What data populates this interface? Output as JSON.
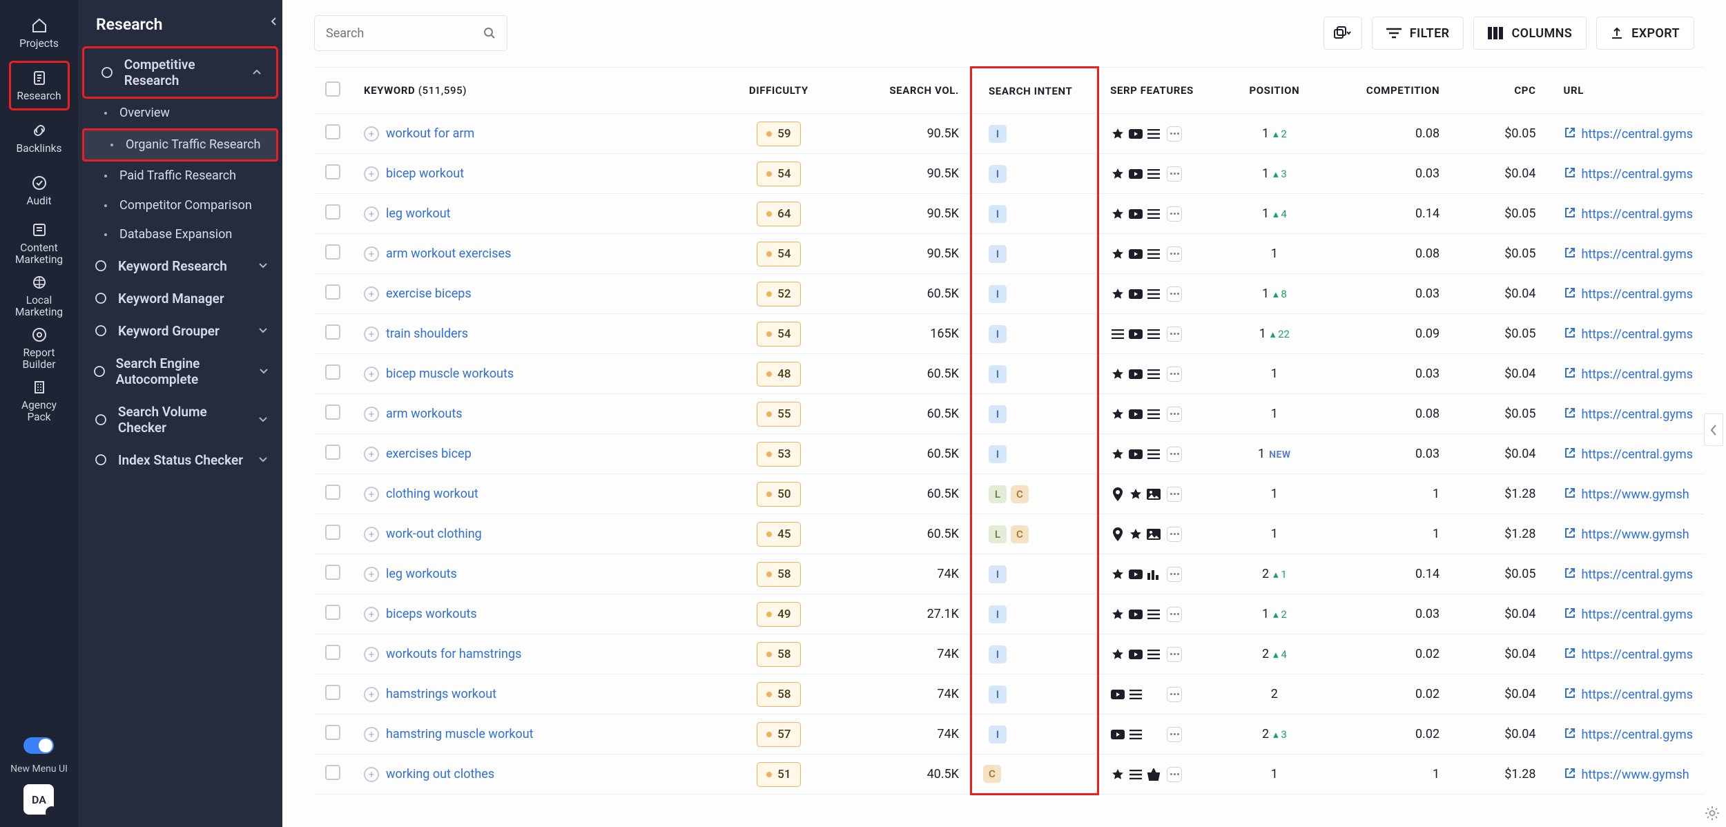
{
  "rail": {
    "items": [
      {
        "label": "Projects",
        "icon": "home-icon"
      },
      {
        "label": "Research",
        "icon": "doc-icon",
        "highlighted": true
      },
      {
        "label": "Backlinks",
        "icon": "link-icon"
      },
      {
        "label": "Audit",
        "icon": "check-icon"
      },
      {
        "label": "Content Marketing",
        "icon": "content-icon"
      },
      {
        "label": "Local Marketing",
        "icon": "local-icon"
      },
      {
        "label": "Report Builder",
        "icon": "report-icon"
      },
      {
        "label": "Agency Pack",
        "icon": "building-icon"
      }
    ],
    "toggle_label": "New Menu UI",
    "avatar": "DA"
  },
  "side": {
    "title": "Research",
    "groups": [
      {
        "label": "Competitive Research",
        "expanded": true,
        "highlighted": true,
        "children": [
          {
            "label": "Overview"
          },
          {
            "label": "Organic Traffic Research",
            "active": true,
            "highlighted": true
          },
          {
            "label": "Paid Traffic Research"
          },
          {
            "label": "Competitor Comparison"
          },
          {
            "label": "Database Expansion",
            "icon": "expand-icon"
          }
        ]
      },
      {
        "label": "Keyword Research",
        "expandable": true
      },
      {
        "label": "Keyword Manager"
      },
      {
        "label": "Keyword Grouper",
        "expandable": true
      },
      {
        "label": "Search Engine Autocomplete",
        "expandable": true
      },
      {
        "label": "Search Volume Checker",
        "expandable": true
      },
      {
        "label": "Index Status Checker",
        "expandable": true
      }
    ]
  },
  "toolbar": {
    "search_placeholder": "Search",
    "filter": "FILTER",
    "columns": "COLUMNS",
    "export": "EXPORT"
  },
  "columns": {
    "keyword": "KEYWORD",
    "keyword_count": "(511,595)",
    "difficulty": "DIFFICULTY",
    "search_vol": "SEARCH VOL.",
    "search_intent": "SEARCH INTENT",
    "serp": "SERP FEATURES",
    "position": "POSITION",
    "competition": "COMPETITION",
    "cpc": "CPC",
    "url": "URL"
  },
  "rows": [
    {
      "kw": "workout for arm",
      "diff": "59",
      "vol": "90.5K",
      "intent": [
        "I"
      ],
      "serp": [
        "star",
        "video",
        "list",
        "more"
      ],
      "pos": "1",
      "delta": "▴ 2",
      "comp": "0.08",
      "cpc": "$0.05",
      "url": "https://central.gyms"
    },
    {
      "kw": "bicep workout",
      "diff": "54",
      "vol": "90.5K",
      "intent": [
        "I"
      ],
      "serp": [
        "star",
        "video",
        "list",
        "more"
      ],
      "pos": "1",
      "delta": "▴ 3",
      "comp": "0.03",
      "cpc": "$0.04",
      "url": "https://central.gyms"
    },
    {
      "kw": "leg workout",
      "diff": "64",
      "vol": "90.5K",
      "intent": [
        "I"
      ],
      "serp": [
        "star",
        "video",
        "list",
        "more"
      ],
      "pos": "1",
      "delta": "▴ 4",
      "comp": "0.14",
      "cpc": "$0.05",
      "url": "https://central.gyms"
    },
    {
      "kw": "arm workout exercises",
      "diff": "54",
      "vol": "90.5K",
      "intent": [
        "I"
      ],
      "serp": [
        "star",
        "video",
        "list",
        "more"
      ],
      "pos": "1",
      "delta": "",
      "comp": "0.08",
      "cpc": "$0.05",
      "url": "https://central.gyms"
    },
    {
      "kw": "exercise biceps",
      "diff": "52",
      "vol": "60.5K",
      "intent": [
        "I"
      ],
      "serp": [
        "star",
        "video",
        "list",
        "more"
      ],
      "pos": "1",
      "delta": "▴ 8",
      "comp": "0.03",
      "cpc": "$0.04",
      "url": "https://central.gyms"
    },
    {
      "kw": "train shoulders",
      "diff": "54",
      "vol": "165K",
      "intent": [
        "I"
      ],
      "serp": [
        "list",
        "video",
        "list",
        "more"
      ],
      "pos": "1",
      "delta": "▴ 22",
      "comp": "0.09",
      "cpc": "$0.05",
      "url": "https://central.gyms"
    },
    {
      "kw": "bicep muscle workouts",
      "diff": "48",
      "vol": "60.5K",
      "intent": [
        "I"
      ],
      "serp": [
        "star",
        "video",
        "list",
        "more"
      ],
      "pos": "1",
      "delta": "",
      "comp": "0.03",
      "cpc": "$0.04",
      "url": "https://central.gyms"
    },
    {
      "kw": "arm workouts",
      "diff": "55",
      "vol": "60.5K",
      "intent": [
        "I"
      ],
      "serp": [
        "star",
        "video",
        "list",
        "more"
      ],
      "pos": "1",
      "delta": "",
      "comp": "0.08",
      "cpc": "$0.05",
      "url": "https://central.gyms"
    },
    {
      "kw": "exercises bicep",
      "diff": "53",
      "vol": "60.5K",
      "intent": [
        "I"
      ],
      "serp": [
        "star",
        "video",
        "list",
        "more"
      ],
      "pos": "1",
      "delta": "NEW",
      "comp": "0.03",
      "cpc": "$0.04",
      "url": "https://central.gyms"
    },
    {
      "kw": "clothing workout",
      "diff": "50",
      "vol": "60.5K",
      "intent": [
        "L",
        "C"
      ],
      "serp": [
        "pin",
        "star",
        "image",
        "more"
      ],
      "pos": "1",
      "delta": "",
      "comp": "1",
      "cpc": "$1.28",
      "url": "https://www.gymsh"
    },
    {
      "kw": "work-out clothing",
      "diff": "45",
      "vol": "60.5K",
      "intent": [
        "L",
        "C"
      ],
      "serp": [
        "pin",
        "star",
        "image",
        "more"
      ],
      "pos": "1",
      "delta": "",
      "comp": "1",
      "cpc": "$1.28",
      "url": "https://www.gymsh"
    },
    {
      "kw": "leg workouts",
      "diff": "58",
      "vol": "74K",
      "intent": [
        "I"
      ],
      "serp": [
        "star",
        "video",
        "bars",
        "more"
      ],
      "pos": "2",
      "delta": "▴ 1",
      "comp": "0.14",
      "cpc": "$0.05",
      "url": "https://central.gyms"
    },
    {
      "kw": "biceps workouts",
      "diff": "49",
      "vol": "27.1K",
      "intent": [
        "I"
      ],
      "serp": [
        "star",
        "video",
        "list",
        "more"
      ],
      "pos": "1",
      "delta": "▴ 2",
      "comp": "0.03",
      "cpc": "$0.04",
      "url": "https://central.gyms"
    },
    {
      "kw": "workouts for hamstrings",
      "diff": "58",
      "vol": "74K",
      "intent": [
        "I"
      ],
      "serp": [
        "star",
        "video",
        "list",
        "more"
      ],
      "pos": "2",
      "delta": "▴ 4",
      "comp": "0.02",
      "cpc": "$0.04",
      "url": "https://central.gyms"
    },
    {
      "kw": "hamstrings workout",
      "diff": "58",
      "vol": "74K",
      "intent": [
        "I"
      ],
      "serp": [
        "video",
        "list",
        "",
        "more"
      ],
      "pos": "2",
      "delta": "",
      "comp": "0.02",
      "cpc": "$0.04",
      "url": "https://central.gyms"
    },
    {
      "kw": "hamstring muscle workout",
      "diff": "57",
      "vol": "74K",
      "intent": [
        "I"
      ],
      "serp": [
        "video",
        "list",
        "",
        "more"
      ],
      "pos": "2",
      "delta": "▴ 3",
      "comp": "0.02",
      "cpc": "$0.04",
      "url": "https://central.gyms"
    },
    {
      "kw": "working out clothes",
      "diff": "51",
      "vol": "40.5K",
      "intent": [
        "C"
      ],
      "serp": [
        "star",
        "list",
        "basket",
        "more"
      ],
      "pos": "1",
      "delta": "",
      "comp": "1",
      "cpc": "$1.28",
      "url": "https://www.gymsh"
    }
  ]
}
